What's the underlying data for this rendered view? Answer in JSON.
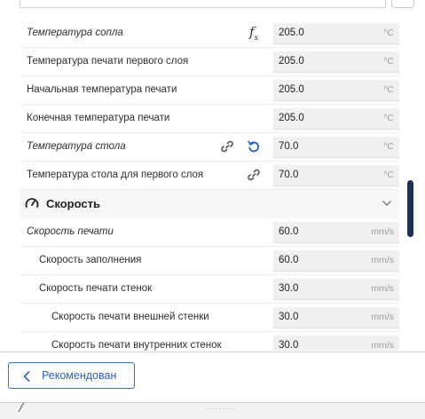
{
  "material": {
    "rows": [
      {
        "label": "Температура сопла",
        "value": "205.0",
        "unit": "°C"
      },
      {
        "label": "Температура печати первого слоя",
        "value": "205.0",
        "unit": "°C"
      },
      {
        "label": "Начальная температура печати",
        "value": "205.0",
        "unit": "°C"
      },
      {
        "label": "Конечная температура печати",
        "value": "205.0",
        "unit": "°C"
      },
      {
        "label": "Температура стола",
        "value": "70.0",
        "unit": "°C"
      },
      {
        "label": "Температура стола для первого слоя",
        "value": "70.0",
        "unit": "°C"
      }
    ]
  },
  "speed": {
    "title": "Скорость",
    "rows": [
      {
        "label": "Скорость печати",
        "value": "60.0",
        "unit": "mm/s"
      },
      {
        "label": "Скорость заполнения",
        "value": "60.0",
        "unit": "mm/s"
      },
      {
        "label": "Скорость печати стенок",
        "value": "30.0",
        "unit": "mm/s"
      },
      {
        "label": "Скорость печати внешней стенки",
        "value": "30.0",
        "unit": "mm/s"
      },
      {
        "label": "Скорость печати внутренних стенок",
        "value": "30.0",
        "unit": "mm/s"
      }
    ]
  },
  "footer": {
    "recommended_label": "Рекомендован"
  },
  "icons": {
    "accent": "#2b5fb8",
    "scrollbar": "#1f2f5c"
  }
}
